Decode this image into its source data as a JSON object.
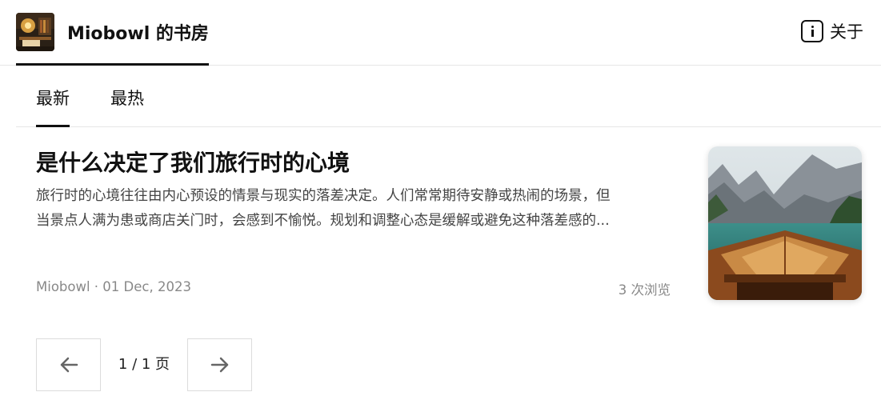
{
  "header": {
    "site_title": "Miobowl 的书房",
    "about_label": "关于",
    "logo_icon": "study-room-logo",
    "about_icon": "info-icon"
  },
  "tabs": [
    {
      "label": "最新",
      "active": true
    },
    {
      "label": "最热",
      "active": false
    }
  ],
  "article": {
    "title": "是什么决定了我们旅行时的心境",
    "summary_line1": "旅行时的心境往往由内心预设的情景与现实的落差决定。人们常常期待安静或热闹的场景，但",
    "summary_line2": "当景点人满为患或商店关门时，会感到不愉悦。规划和调整心态是缓解或避免这种落差感的...",
    "meta": "Miobowl · 01 Dec, 2023",
    "views": "3 次浏览",
    "thumbnail_icon": "lake-boat-thumbnail"
  },
  "pagination": {
    "page_text": "1 / 1 页",
    "prev_icon": "arrow-left-icon",
    "next_icon": "arrow-right-icon"
  }
}
